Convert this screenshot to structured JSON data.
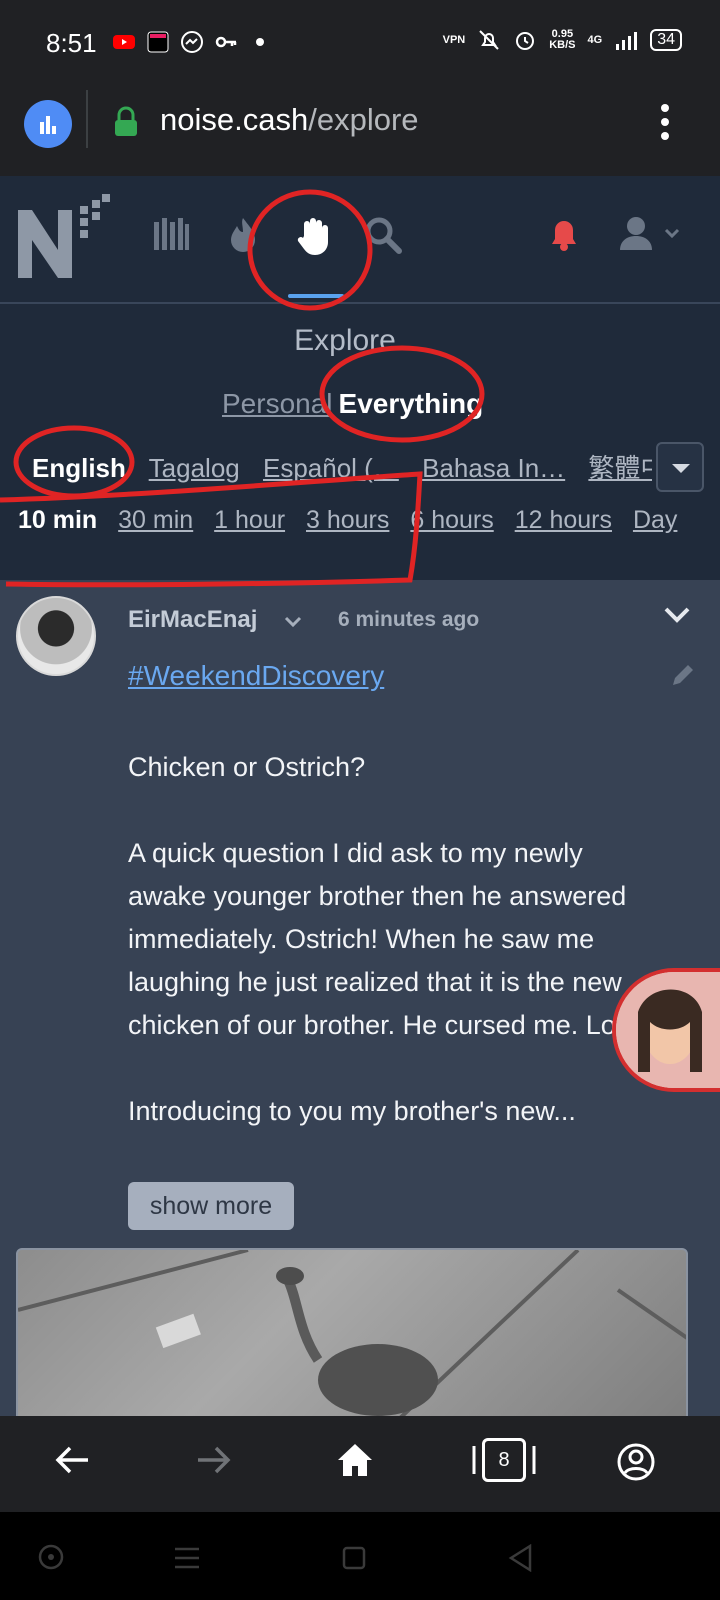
{
  "status_bar": {
    "time": "8:51",
    "net_speed_value": "0.95",
    "net_speed_unit": "KB/S",
    "vpn_label": "VPN",
    "network_type": "4G",
    "battery": "34"
  },
  "browser": {
    "url_domain": "noise.cash",
    "url_path": "/explore",
    "tab_count": "8"
  },
  "header": {
    "nav_icons": [
      "library-icon",
      "trending-icon",
      "explore-hand-icon",
      "search-icon"
    ],
    "accent_color": "#5aa2ee",
    "bell_color": "#e64a4a"
  },
  "explore": {
    "title": "Explore",
    "scope_personal": "Personal",
    "scope_everything": "Everything",
    "languages": [
      "English",
      "Tagalog",
      "Español (…",
      "Bahasa In…",
      "繁體中"
    ],
    "time_filters": [
      "10 min",
      "30 min",
      "1 hour",
      "3 hours",
      "6 hours",
      "12 hours",
      "Day"
    ]
  },
  "post": {
    "author": "EirMacEnaj",
    "time_ago": "6 minutes ago",
    "hashtag": "#WeekendDiscovery",
    "paragraphs": [
      "Chicken or Ostrich?",
      "A quick question I did ask to my newly awake younger brother then he answered immediately. Ostrich! When he saw me laughing he just realized that it is the new chicken of our brother. He cursed me. Lol!",
      "Introducing to you my brother's new..."
    ],
    "show_more": "show more"
  }
}
